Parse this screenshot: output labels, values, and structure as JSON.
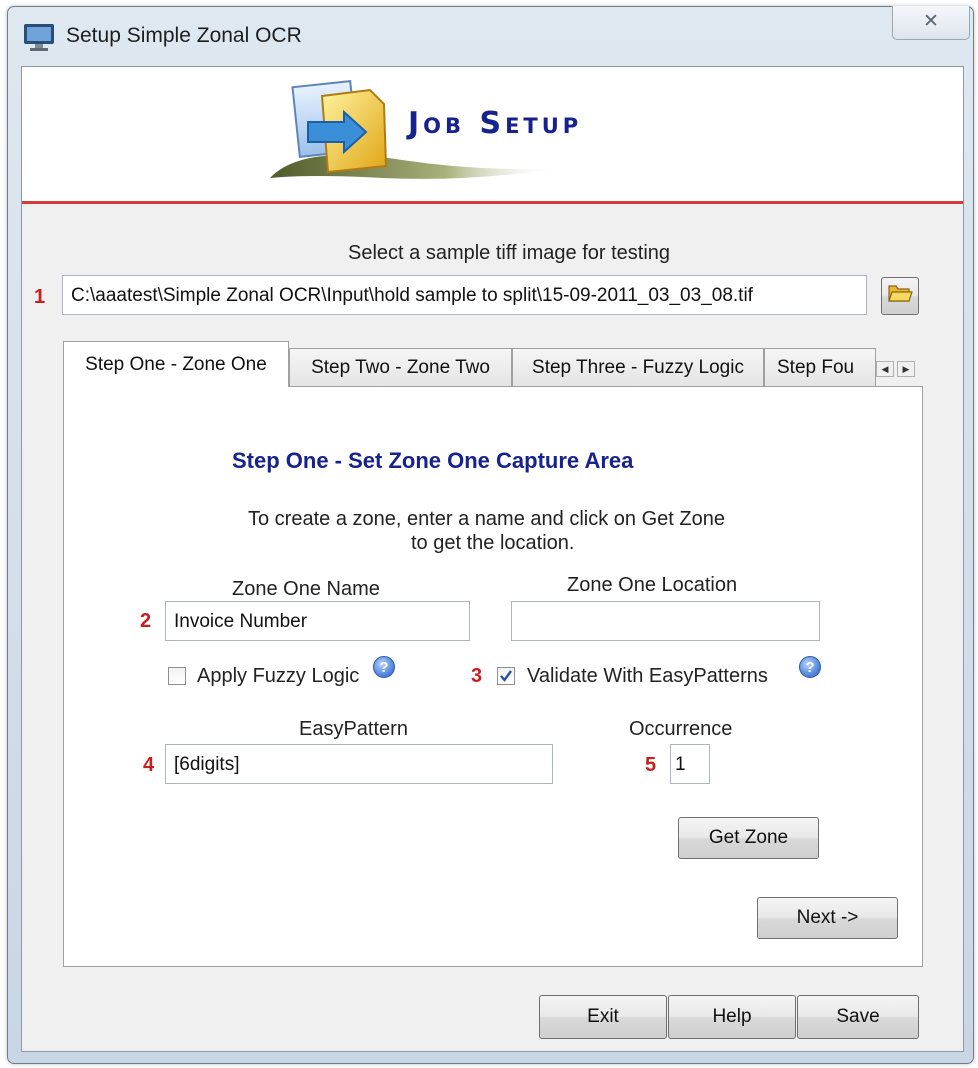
{
  "window": {
    "title": "Setup Simple Zonal OCR",
    "close_glyph": "✕"
  },
  "header": {
    "title": "Job Setup"
  },
  "sample": {
    "label": "Select a sample tiff image for testing",
    "step_number": "1",
    "path": "C:\\aaatest\\Simple Zonal OCR\\Input\\hold sample to split\\15-09-2011_03_03_08.tif",
    "browse_icon": "open-folder-icon"
  },
  "tabs": [
    {
      "label": "Step One - Zone One",
      "active": true
    },
    {
      "label": "Step Two - Zone Two",
      "active": false
    },
    {
      "label": "Step Three - Fuzzy Logic",
      "active": false
    },
    {
      "label": "Step Fou",
      "active": false
    }
  ],
  "tab_scroll": {
    "left": "◀",
    "right": "▶"
  },
  "panel": {
    "heading": "Step One - Set Zone One Capture Area",
    "instructions_line1": "To create a zone, enter a name and click on Get Zone",
    "instructions_line2": "to get the location.",
    "zone_name_label": "Zone One Name",
    "zone_name_number": "2",
    "zone_name_value": "Invoice Number",
    "zone_location_label": "Zone One Location",
    "zone_location_value": "",
    "fuzzy_label": "Apply Fuzzy Logic",
    "fuzzy_checked": false,
    "validate_number": "3",
    "validate_label": "Validate With EasyPatterns",
    "validate_checked": true,
    "pattern_label": "EasyPattern",
    "pattern_number": "4",
    "pattern_value": "[6digits]",
    "occurrence_label": "Occurrence",
    "occurrence_number": "5",
    "occurrence_value": "1",
    "get_zone_label": "Get Zone",
    "next_label": "Next ->"
  },
  "footer": {
    "exit_label": "Exit",
    "help_label": "Help",
    "save_label": "Save"
  },
  "colors": {
    "accent_red": "#d63a3a",
    "heading_blue": "#17238c",
    "number_red": "#c81e1e"
  }
}
